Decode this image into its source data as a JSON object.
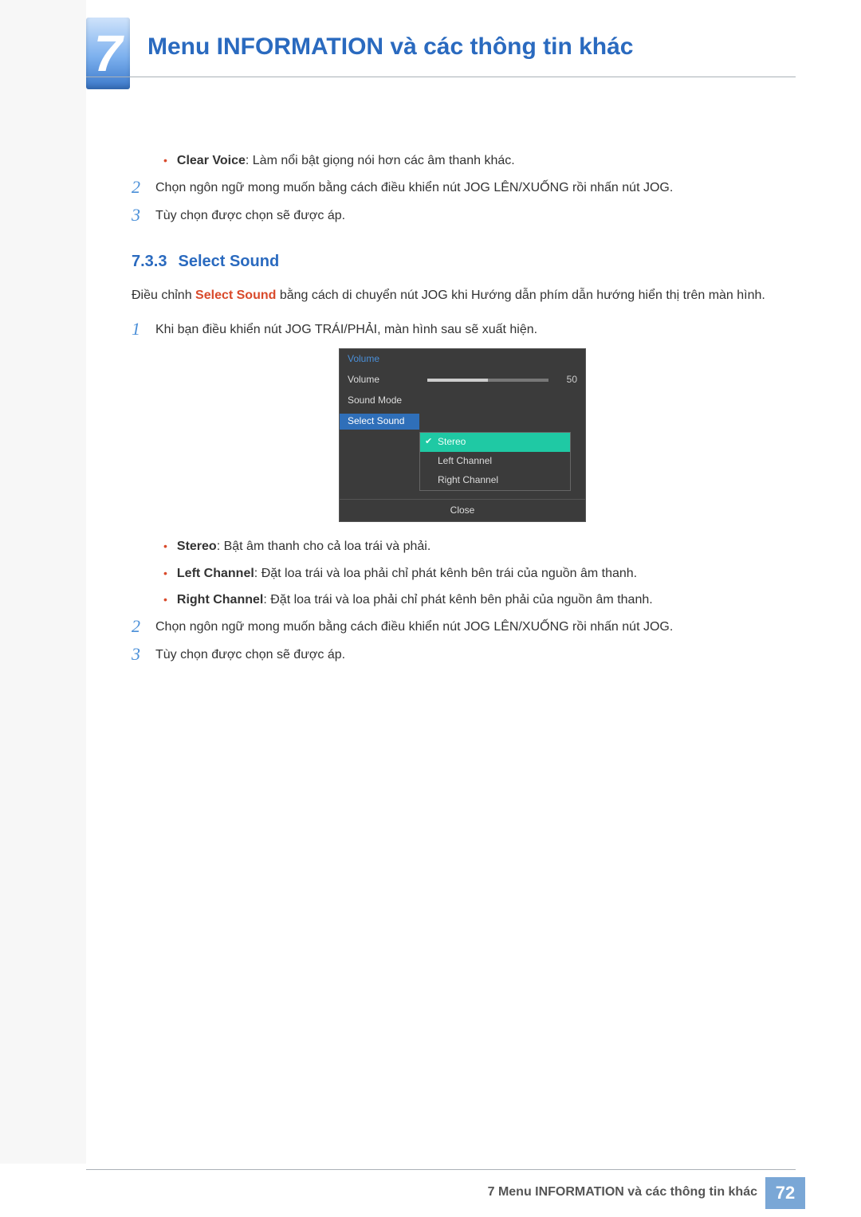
{
  "chapter": {
    "number": "7",
    "title": "Menu INFORMATION và các thông tin khác"
  },
  "top": {
    "clear_voice_label": "Clear Voice",
    "clear_voice_desc": ": Làm nổi bật giọng nói hơn các âm thanh khác.",
    "step2": "Chọn ngôn ngữ mong muốn bằng cách điều khiển nút JOG LÊN/XUỐNG rồi nhấn nút JOG.",
    "step3": "Tùy chọn được chọn sẽ được áp."
  },
  "section": {
    "num": "7.3.3",
    "title": "Select Sound",
    "intro_pre": "Điều chỉnh ",
    "intro_bold": "Select Sound",
    "intro_post": " bằng cách di chuyển nút JOG khi Hướng dẫn phím dẫn hướng hiển thị trên màn hình.",
    "step1": "Khi bạn điều khiển nút JOG TRÁI/PHẢI, màn hình sau sẽ xuất hiện.",
    "step2": "Chọn ngôn ngữ mong muốn bằng cách điều khiển nút JOG LÊN/XUỐNG rồi nhấn nút JOG.",
    "step3": "Tùy chọn được chọn sẽ được áp.",
    "stereo_label": "Stereo",
    "stereo_desc": ": Bật âm thanh cho cả loa trái và phải.",
    "left_label": "Left Channel",
    "left_desc": ": Đặt loa trái và loa phải chỉ phát kênh bên trái của nguồn âm thanh.",
    "right_label": "Right Channel",
    "right_desc": ": Đặt loa trái và loa phải chỉ phát kênh bên phải của nguồn âm thanh."
  },
  "osd": {
    "title": "Volume",
    "row_volume": "Volume",
    "volume_value": "50",
    "volume_fill_pct": "50%",
    "row_soundmode": "Sound Mode",
    "row_selectsound": "Select Sound",
    "opt_stereo": "Stereo",
    "opt_left": "Left Channel",
    "opt_right": "Right Channel",
    "close": "Close"
  },
  "footer": {
    "text": "7 Menu INFORMATION và các thông tin khác",
    "page": "72"
  },
  "nums": {
    "n1": "1",
    "n2": "2",
    "n3": "3"
  }
}
